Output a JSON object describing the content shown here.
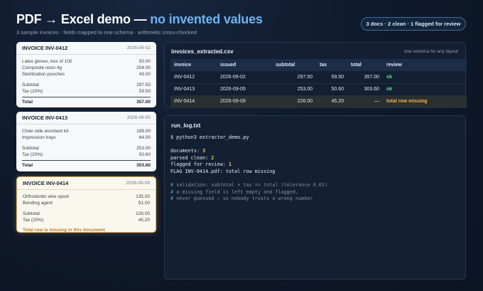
{
  "header": {
    "title_main": "PDF → Excel demo — ",
    "title_accent": "no invented values",
    "subtitle": "3 sample invoices · fields mapped to one schema · arithmetic cross-checked",
    "summary_badge": "3 docs · 2 clean · 1 flagged for review"
  },
  "invoices": [
    {
      "id": "INVOICE INV-0412",
      "date": "2026-09-02",
      "items": [
        {
          "label": "Latex gloves, box of 100",
          "amount": "50.00"
        },
        {
          "label": "Composite resin 4g",
          "amount": "204.00"
        },
        {
          "label": "Sterilization pouches",
          "amount": "43.50"
        }
      ],
      "subtotal_label": "Subtotal",
      "subtotal": "297.50",
      "tax_label": "Tax (20%)",
      "tax": "59.50",
      "total_label": "Total",
      "total": "357.00"
    },
    {
      "id": "INVOICE INV-0413",
      "date": "2026-09-05",
      "items": [
        {
          "label": "Chair-side assistant kit",
          "amount": "189.00"
        },
        {
          "label": "Impression trays",
          "amount": "64.00"
        }
      ],
      "subtotal_label": "Subtotal",
      "subtotal": "253.00",
      "tax_label": "Tax (20%)",
      "tax": "50.60",
      "total_label": "Total",
      "total": "303.60"
    },
    {
      "id": "INVOICE INV-0414",
      "date": "2026-09-09",
      "items": [
        {
          "label": "Orthodontic wire spool",
          "amount": "135.00"
        },
        {
          "label": "Bonding agent",
          "amount": "91.00"
        }
      ],
      "subtotal_label": "Subtotal",
      "subtotal": "226.00",
      "tax_label": "Tax (20%)",
      "tax": "45.20",
      "missing_note": "Total row is missing in this document"
    }
  ],
  "csv": {
    "title": "invoices_extracted.csv",
    "note": "one schema for any layout",
    "columns": [
      "invoice",
      "issued",
      "subtotal",
      "tax",
      "total",
      "review"
    ],
    "rows": [
      [
        "INV-0412",
        "2026-09-02",
        "297.50",
        "59.50",
        "357.00",
        "ok"
      ],
      [
        "INV-0413",
        "2026-09-05",
        "253.00",
        "50.60",
        "303.60",
        "ok"
      ],
      [
        "INV-0414",
        "2026-09-09",
        "226.00",
        "45.20",
        "—",
        "total row missing"
      ]
    ]
  },
  "log": {
    "title": "run_log.txt",
    "command": "$ python3 extractor_demo.py",
    "documents_label": "documents: ",
    "documents_value": "3",
    "parsed_label": "parsed clean: ",
    "parsed_value": "2",
    "flagged_label": "flagged for review: ",
    "flagged_value": "1",
    "flag_line": "FLAG INV-0414.pdf: total row missing",
    "comments": [
      "# validation: subtotal + tax == total (tolerance 0.01)",
      "# a missing field is left empty and flagged,",
      "# never guessed — so nobody trusts a wrong number"
    ]
  },
  "colors": {
    "accent": "#6cb4f2",
    "ok": "#67d08b",
    "warning": "#f0b04e",
    "flag_border": "#e5b25b"
  }
}
